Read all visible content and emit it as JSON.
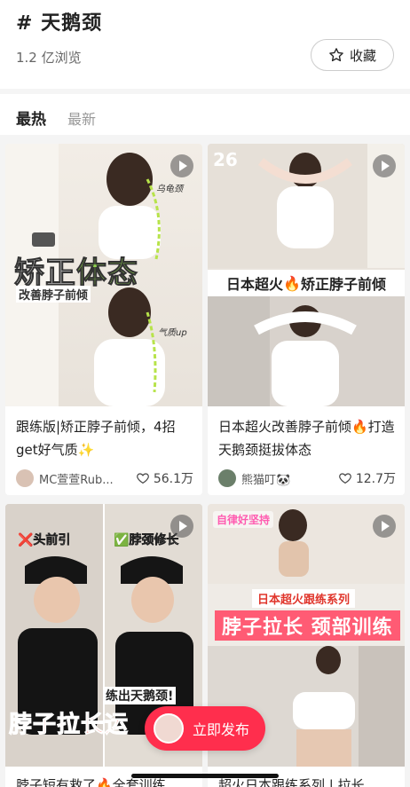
{
  "topic": {
    "title": "# 天鹅颈",
    "views": "1.2 亿浏览",
    "collect_label": "收藏"
  },
  "tabs": [
    {
      "label": "最热",
      "active": true
    },
    {
      "label": "最新",
      "active": false
    }
  ],
  "cards": [
    {
      "title": "跟练版|矫正脖子前倾，4招get好气质✨",
      "author": "MC萱萱Rub...",
      "likes": "56.1万",
      "overlay": {
        "main_white": "矫正",
        "main_green": "体态",
        "sub": "改善脖子前倾",
        "note_top": "乌龟颈",
        "note_bottom": "气质up"
      }
    },
    {
      "title": "日本超火改善脖子前倾🔥打造天鹅颈挺拔体态",
      "author": "熊猫叮🐼",
      "likes": "12.7万",
      "overlay": {
        "number": "26",
        "band_left": "日本超火",
        "band_fire": "🔥",
        "band_right": "矫正脖子前倾"
      }
    },
    {
      "title": "脖子短有救了🔥全套训练",
      "overlay": {
        "left_label": "❌头前引",
        "right_label": "✅脖颈修长",
        "mid_text": "练出天鹅颈!",
        "big_text": "脖子拉长运"
      }
    },
    {
      "title": "超火日本跟练系列 | 拉长",
      "overlay": {
        "tag": "自律好坚持",
        "line1": "日本超火跟练系列",
        "line2": "脖子拉长 颈部训练"
      }
    }
  ],
  "publish": {
    "label": "立即发布"
  },
  "colors": {
    "accent": "#ff2e4d",
    "green": "#8fd14f"
  }
}
